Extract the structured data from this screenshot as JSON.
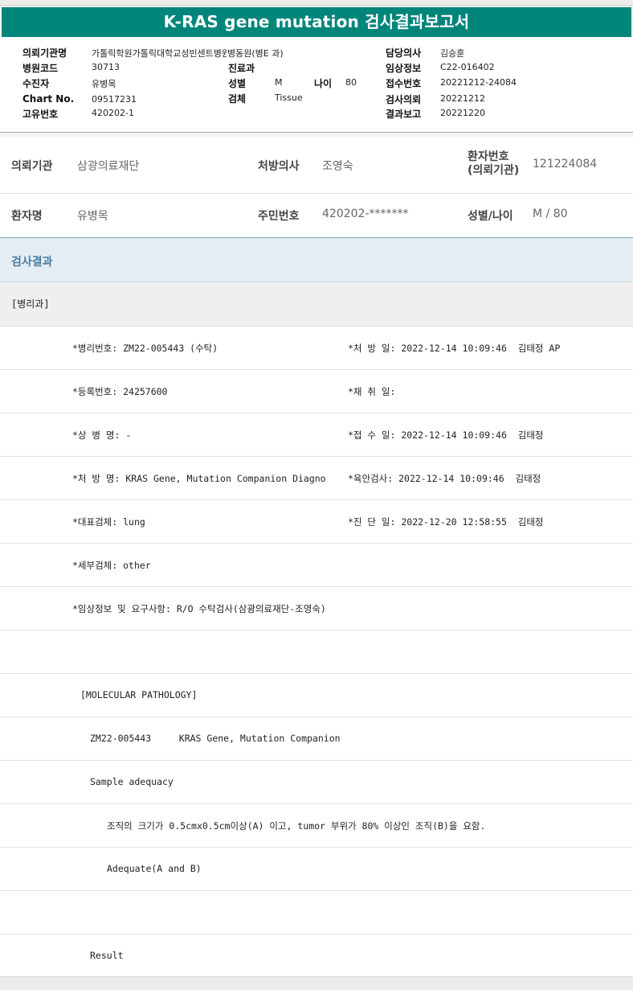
{
  "title": "K-RAS gene mutation 검사결과보고서",
  "header": {
    "institution_label": "의뢰기관명",
    "institution_value": "가톨릭학원가톨릭대학교성빈센트병원(병동 과)",
    "hospital_code_label": "병원코드",
    "hospital_code_value": "30713",
    "dept_label": "진료과",
    "patient_label": "수진자",
    "patient_value": "유병목",
    "sex_label": "성별",
    "sex_value": "M",
    "age_label": "나이",
    "age_value": "80",
    "chart_label": "Chart No.",
    "chart_value": "09517231",
    "specimen_label": "검체",
    "specimen_value": "Tissue",
    "unique_label": "고유번호",
    "unique_value": "420202-1",
    "doctor_label": "담당의사",
    "doctor_value": "김승훈",
    "clinical_label": "임상정보",
    "clinical_value": "C22-016402",
    "receipt_label": "접수번호",
    "receipt_value": "20221212-24084",
    "request_label": "검사의뢰",
    "request_value": "20221212",
    "report_label": "결과보고",
    "report_value": "20221220"
  },
  "info": {
    "req_inst_label": "의뢰기관",
    "req_inst_value": "삼광의료재단",
    "prescriber_label": "처방의사",
    "prescriber_value": "조영숙",
    "patient_no_label_line1": "환자번호",
    "patient_no_label_line2": "(의뢰기관)",
    "patient_no_value": "121224084",
    "patient_name_label": "환자명",
    "patient_name_value": "유병목",
    "resident_no_label": "주민번호",
    "resident_no_value": "420202-*******",
    "sex_age_label": "성별/나이",
    "sex_age_value": "M / 80"
  },
  "section_title": "검사결과",
  "dept": "[병리과]",
  "rows": [
    {
      "left": "*병리번호: ZM22-005443 (수탁)",
      "right": "*처 방 일: 2022-12-14 10:09:46  김태정 AP"
    },
    {
      "left": "*등록번호: 24257600",
      "right": "*채 취 일:"
    },
    {
      "left": "*상 병 명: -",
      "right": "*접 수 일: 2022-12-14 10:09:46  김태정"
    },
    {
      "left": "*처 방 명: KRAS Gene, Mutation Companion Diagno",
      "right": "*육안검사: 2022-12-14 10:09:46  김태정"
    },
    {
      "left": "*대표검체: lung",
      "right": "*진 단 일: 2022-12-20 12:58:55  김태정"
    },
    {
      "left": "*세부검체: other",
      "right": ""
    },
    {
      "left": "*임상정보 및 요구사항: R/O 수탁검사(삼광의료재단-조영숙)",
      "right": ""
    }
  ],
  "report": {
    "molecular_title": "[MOLECULAR PATHOLOGY]",
    "case_line": "ZM22-005443     KRAS Gene, Mutation Companion",
    "sample_adequacy": "Sample adequacy",
    "criteria": "조직의 크기가 0.5cmx0.5cm이상(A) 이고, tumor 부위가 80% 이상인 조직(B)을 요함.",
    "adequate": "Adequate(A and B)",
    "result": "Result"
  }
}
